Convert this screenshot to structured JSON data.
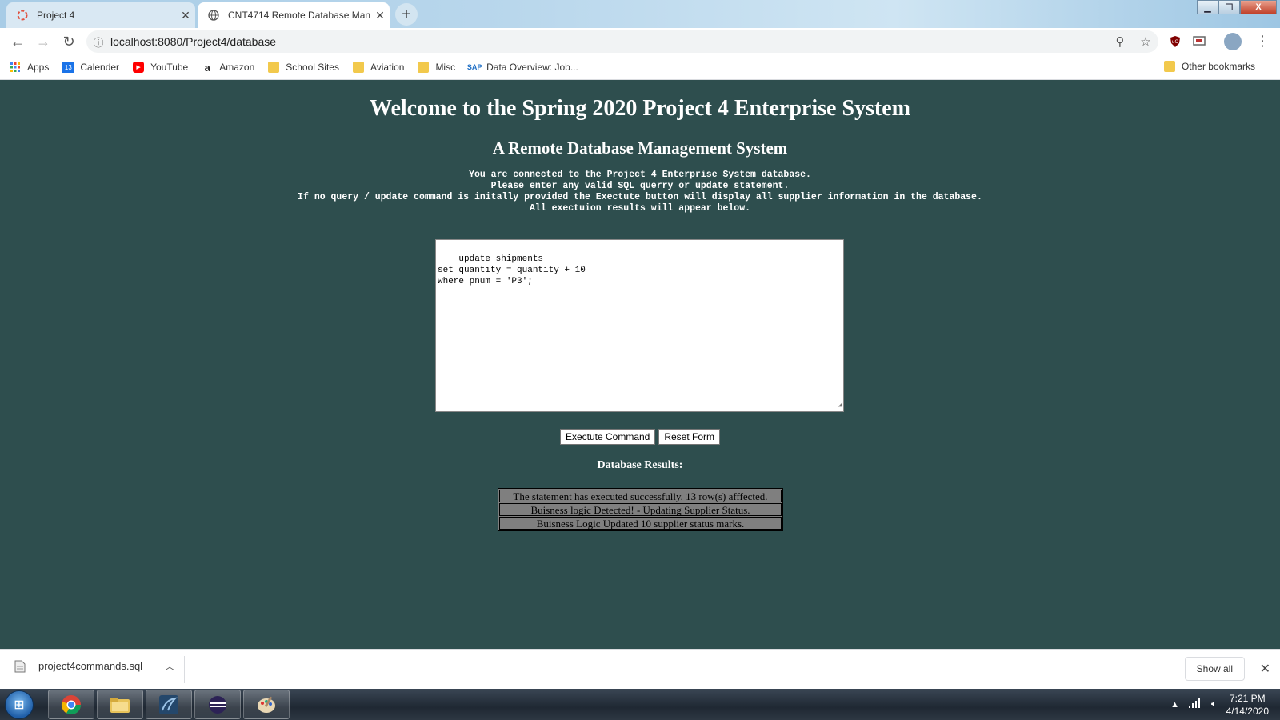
{
  "browser": {
    "tabs": [
      {
        "title": "Project 4",
        "active": false
      },
      {
        "title": "CNT4714 Remote Database Man",
        "active": true
      }
    ],
    "address": "localhost:8080/Project4/database",
    "bookmarks": [
      {
        "label": "Apps",
        "icon": "apps-grid-icon"
      },
      {
        "label": "Calender",
        "icon": "calendar-icon"
      },
      {
        "label": "YouTube",
        "icon": "youtube-icon"
      },
      {
        "label": "Amazon",
        "icon": "amazon-icon"
      },
      {
        "label": "School Sites",
        "icon": "folder-icon"
      },
      {
        "label": "Aviation",
        "icon": "folder-icon"
      },
      {
        "label": "Misc",
        "icon": "folder-icon"
      },
      {
        "label": "Data Overview: Job...",
        "icon": "data-icon"
      }
    ],
    "other_bookmarks": "Other bookmarks"
  },
  "page": {
    "title": "Welcome to the Spring 2020 Project 4 Enterprise System",
    "subtitle": "A Remote Database Management System",
    "intro_lines": [
      "You are connected to the Project 4 Enterprise System database.",
      "Please enter any valid SQL querry or update statement.",
      "If no query / update command is initally provided the Exectute button will display all supplier information in the database.",
      "All exectuion results will appear below."
    ],
    "sql_text": "update shipments\nset quantity = quantity + 10\nwhere pnum = 'P3';",
    "execute_label": "Exectute Command",
    "reset_label": "Reset Form",
    "results_heading": "Database Results:",
    "results": [
      "The statement has executed successfully. 13 row(s) afffected.",
      "Buisness logic Detected! - Updating Supplier Status.",
      "Buisness Logic Updated 10 supplier status marks."
    ]
  },
  "downloads": {
    "file": "project4commands.sql",
    "show_all": "Show all"
  },
  "taskbar": {
    "time": "7:21 PM",
    "date": "4/14/2020"
  }
}
